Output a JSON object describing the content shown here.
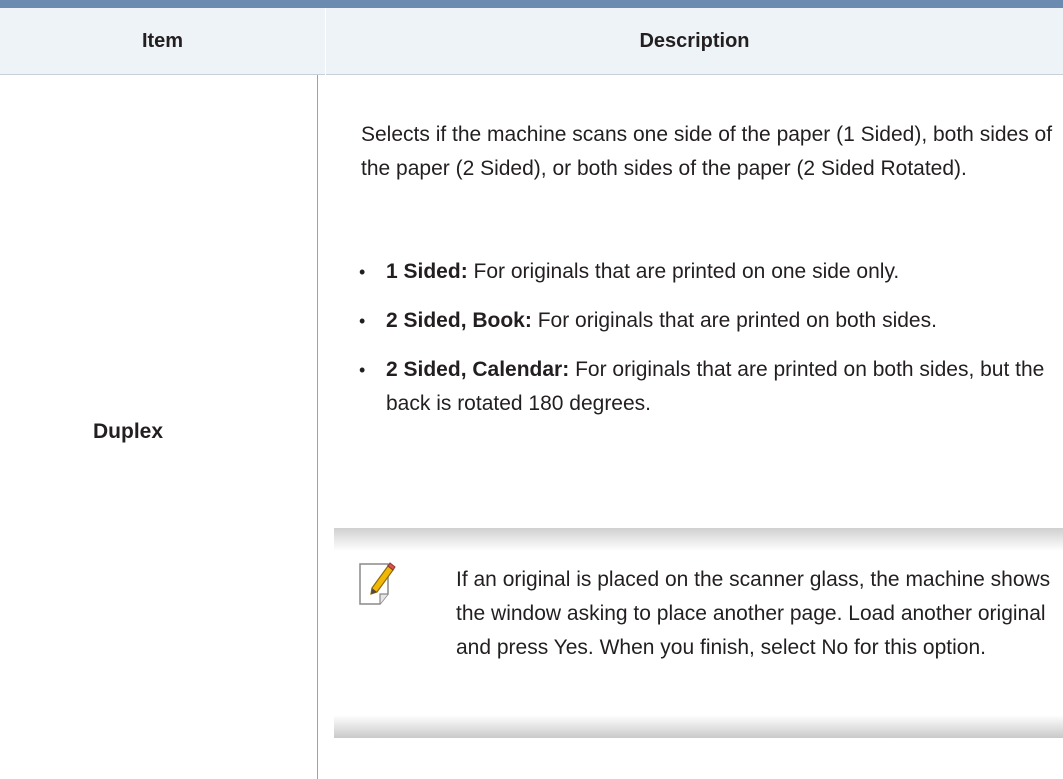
{
  "table": {
    "headers": {
      "item": "Item",
      "description": "Description"
    },
    "row": {
      "item": "Duplex",
      "description": "Selects if the machine scans one side of the paper (1 Sided), both sides of the paper (2 Sided), or both sides of the paper (2 Sided Rotated).",
      "options": [
        {
          "term": "1 Sided:",
          "text": "For originals that are printed on one side only."
        },
        {
          "term": "2 Sided, Book:",
          "text": "For originals that are printed on both sides."
        },
        {
          "term": "2 Sided, Calendar:",
          "text": "For originals that are printed on both sides, but the back is rotated 180 degrees."
        }
      ],
      "note": {
        "icon": "note-pencil-icon",
        "text": "If an original is placed on the scanner glass, the machine shows the window asking to place another page. Load another original and press Yes. When you finish, select No for this option."
      }
    }
  },
  "colors": {
    "header_bg": "#eef3f8",
    "top_rule": "#6b8bb0",
    "text": "#231f20"
  }
}
